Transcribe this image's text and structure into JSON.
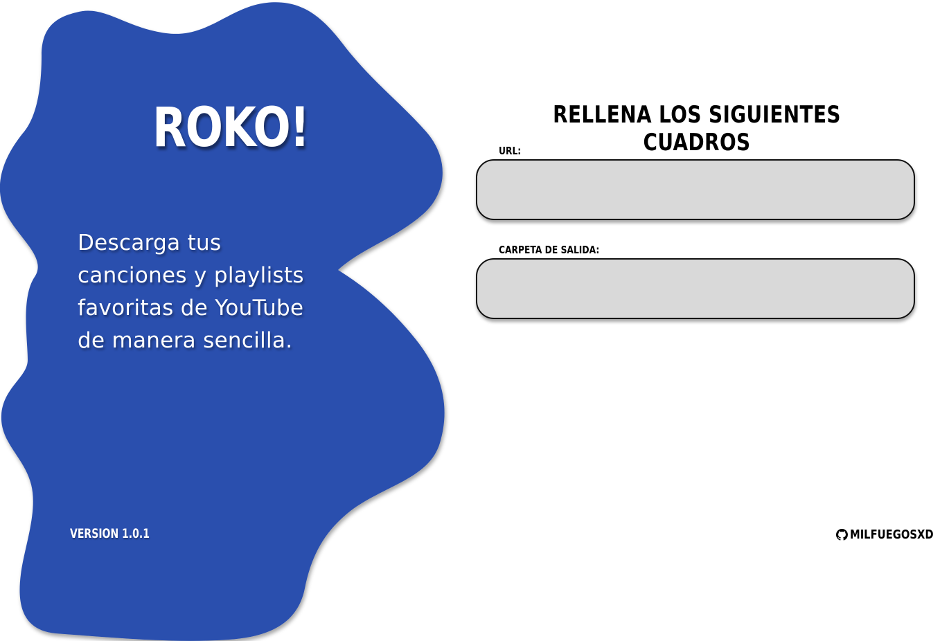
{
  "sidebar": {
    "app_title": "ROKO!",
    "tagline": "Descarga tus canciones y playlists favoritas de YouTube de manera sencilla.",
    "version": "Version 1.0.1",
    "accent_color": "#2b50ae"
  },
  "form": {
    "heading": "Rellena los siguientes cuadros",
    "url_label": "URL:",
    "url_value": "",
    "output_label": "Carpeta de salida:",
    "output_value": "",
    "field_color": "#d9d9d9"
  },
  "footer": {
    "github_icon": "github-icon",
    "github_user": "milfuegosxd"
  }
}
